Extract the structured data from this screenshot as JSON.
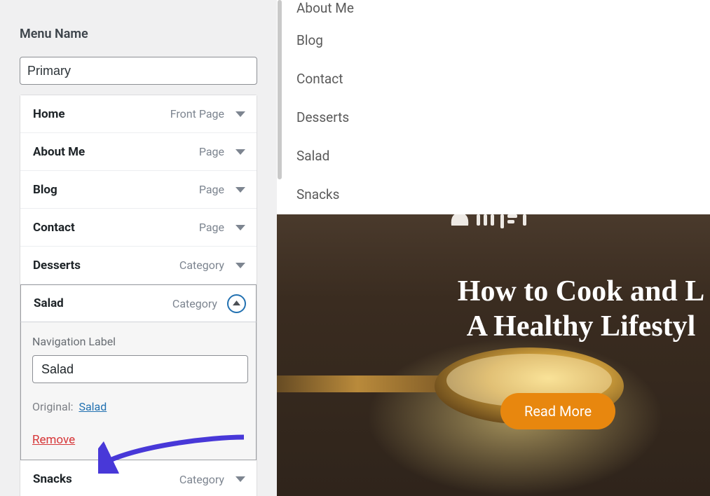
{
  "sidebar": {
    "menu_name_label": "Menu Name",
    "menu_name_value": "Primary",
    "items": [
      {
        "title": "Home",
        "type": "Front Page",
        "expanded": false
      },
      {
        "title": "About Me",
        "type": "Page",
        "expanded": false
      },
      {
        "title": "Blog",
        "type": "Page",
        "expanded": false
      },
      {
        "title": "Contact",
        "type": "Page",
        "expanded": false
      },
      {
        "title": "Desserts",
        "type": "Category",
        "expanded": false
      },
      {
        "title": "Salad",
        "type": "Category",
        "expanded": true
      },
      {
        "title": "Snacks",
        "type": "Category",
        "expanded": false
      }
    ],
    "editor": {
      "nav_label_caption": "Navigation Label",
      "nav_label_value": "Salad",
      "original_prefix": "Original:",
      "original_link": "Salad",
      "remove_label": "Remove"
    }
  },
  "preview": {
    "menu": [
      "About Me",
      "Blog",
      "Contact",
      "Desserts",
      "Salad",
      "Snacks"
    ],
    "hero": {
      "title_line1": "How to Cook and L",
      "title_line2": "A Healthy Lifestyl",
      "button": "Read More"
    }
  },
  "colors": {
    "accent_link": "#2271b1",
    "danger": "#d63638",
    "hero_button": "#e8870e"
  }
}
